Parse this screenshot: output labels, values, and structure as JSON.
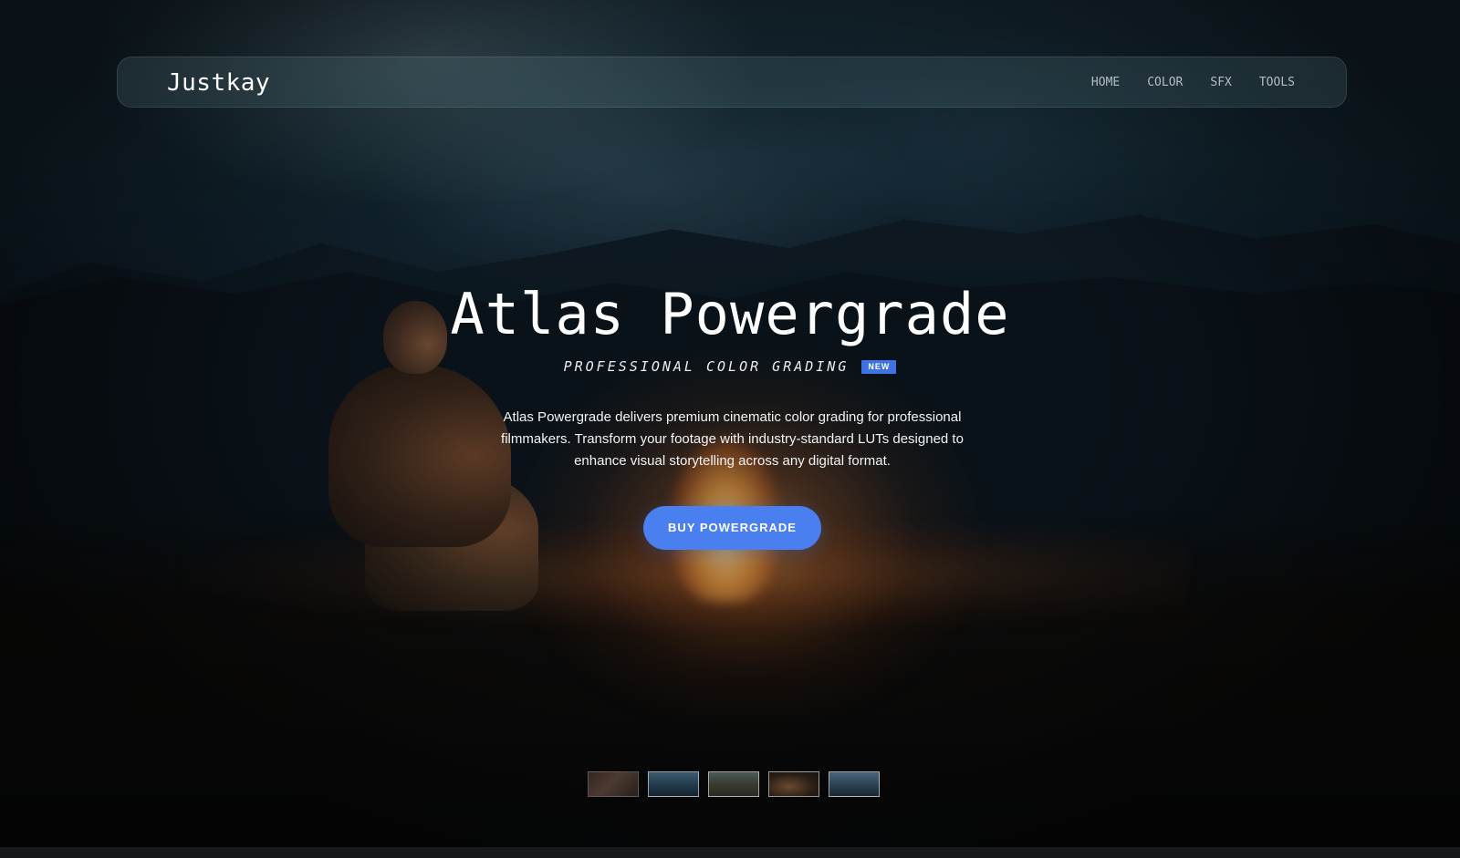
{
  "nav": {
    "brand": "Justkay",
    "links": [
      "HOME",
      "COLOR",
      "SFX",
      "TOOLS"
    ]
  },
  "hero": {
    "title": "Atlas Powergrade",
    "subtitle": "PROFESSIONAL COLOR GRADING",
    "badge": "NEW",
    "description": "Atlas Powergrade delivers premium cinematic color grading for professional filmmakers. Transform your footage with industry-standard LUTs designed to enhance visual storytelling across any digital format.",
    "cta_label": "BUY POWERGRADE"
  },
  "thumbnails": {
    "count": 5,
    "active_index": 0
  },
  "colors": {
    "accent": "#4a7ff0",
    "badge": "#3f73e3"
  }
}
